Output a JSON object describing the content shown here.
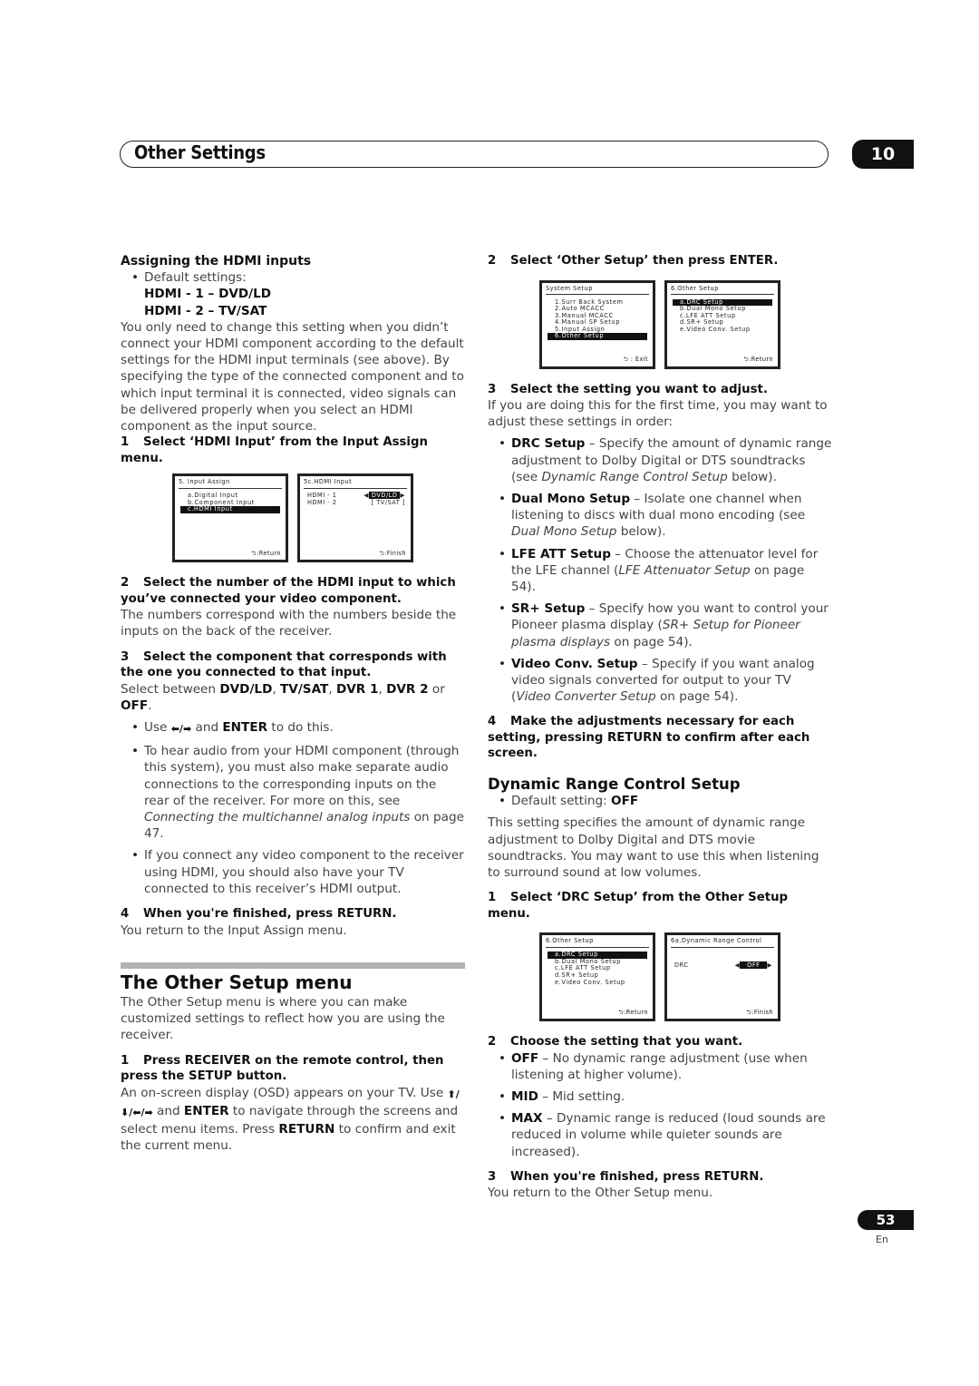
{
  "header": {
    "title": "Other Settings",
    "chapter": "10"
  },
  "left": {
    "hdmi_heading": "Assigning the HDMI inputs",
    "default_label": "Default settings:",
    "defaults": [
      "HDMI - 1 – DVD/LD",
      "HDMI - 2 – TV/SAT"
    ],
    "intro": "You only need to change this setting when you didn’t connect your HDMI component according to the default settings for the HDMI input terminals (see above). By specifying the type of the connected component and to which input terminal it is connected, video signals can be delivered properly when you select an HDMI component as the input source.",
    "step1": {
      "num": "1",
      "text": "Select ‘HDMI Input’ from the Input Assign menu."
    },
    "osd1": {
      "title": "5. Input  Assign",
      "items": [
        "a.Digital  Input",
        "b.Component  Input",
        "c.HDMI Input"
      ],
      "selected": 2,
      "footer": ":Return"
    },
    "osd2": {
      "title": "5c.HDMI  Input",
      "rows": [
        {
          "key": "HDMI - 1",
          "value": "DVD/LD",
          "selected": true
        },
        {
          "key": "HDMI - 2",
          "value": "[  TV/SAT  ]",
          "selected": false
        }
      ],
      "footer": ":Finish"
    },
    "step2": {
      "num": "2",
      "text": "Select the number of the HDMI input to which you’ve connected your video component."
    },
    "step2_body": "The numbers correspond with the numbers beside the inputs on the back of the receiver.",
    "step3": {
      "num": "3",
      "text": "Select the component that corresponds with the one you connected to that input."
    },
    "step3_body_pre": "Select between ",
    "step3_options": [
      "DVD/LD",
      "TV/SAT",
      "DVR 1",
      "DVR 2",
      "OFF"
    ],
    "step3_bullet1": {
      "pre": "Use ",
      "arrows": "⬅/➡",
      "mid": " and ",
      "key": "ENTER",
      "post": " to do this."
    },
    "step3_bullet2": {
      "text": "To hear audio from your HDMI component (through this system), you must also make separate audio connections to the corresponding inputs on the rear of the receiver. For more on this, see ",
      "ref": "Connecting the multichannel analog inputs",
      "post": " on page 47."
    },
    "step3_bullet3": "If you connect any video component to the receiver using HDMI, you should also have your TV connected to this receiver’s HDMI output.",
    "step4": {
      "num": "4",
      "text": "When you're finished, press RETURN."
    },
    "step4_body": "You return to the Input Assign menu.",
    "other_heading": "The Other Setup menu",
    "other_intro": "The Other Setup menu is where you can make customized settings to reflect how you are using the receiver.",
    "os_step1": {
      "num": "1",
      "text": "Press RECEIVER on the remote control, then press the SETUP button."
    },
    "os_step1_body": {
      "pre": "An on-screen display (OSD) appears on your TV. Use ",
      "arrows": "⬆/⬇/⬅/➡",
      "mid": " and ",
      "key1": "ENTER",
      "mid2": " to navigate through the screens and select menu items. Press ",
      "key2": "RETURN",
      "post": " to confirm and exit the current menu."
    }
  },
  "right": {
    "step2": {
      "num": "2",
      "text": "Select ‘Other Setup’ then press ENTER."
    },
    "osd_system": {
      "title": "System  Setup",
      "items": [
        "1.Surr  Back  System",
        "2.Auto  MCACC",
        "3.Manual  MCACC",
        "4.Manual  SP  Setup",
        "5.Input  Assign",
        "6.Other  Setup"
      ],
      "selected": 5,
      "footer": " : Exit"
    },
    "osd_other": {
      "title": "6.Other  Setup",
      "items": [
        "a.DRC  Setup",
        "b.Dual  Mono  Setup",
        "c.LFE  ATT  Setup",
        "d.SR+  Setup",
        "e.Video Conv. Setup"
      ],
      "selected": 0,
      "footer": ":Return"
    },
    "step3": {
      "num": "3",
      "text": "Select the setting you want to adjust."
    },
    "step3_body": "If you are doing this for the first time, you may want to adjust these settings in order:",
    "settings": [
      {
        "name": "DRC Setup",
        "desc": " – Specify the amount of dynamic range adjustment to Dolby Digital or DTS soundtracks (see ",
        "ref": "Dynamic Range Control Setup",
        "post": " below)."
      },
      {
        "name": "Dual Mono Setup",
        "desc": " – Isolate one channel when listening to discs with dual mono encoding (see ",
        "ref": "Dual Mono Setup",
        "post": " below)."
      },
      {
        "name": "LFE ATT Setup",
        "desc": " – Choose the attenuator level for the LFE channel (",
        "ref": "LFE Attenuator Setup",
        "post": " on page 54)."
      },
      {
        "name": "SR+ Setup",
        "desc": " – Specify how you want to control your Pioneer plasma display (",
        "ref": "SR+ Setup for Pioneer plasma displays",
        "post": " on page 54)."
      },
      {
        "name": "Video Conv. Setup",
        "desc": " – Specify if you want analog video signals converted for output to your TV (",
        "ref": "Video Converter Setup",
        "post": " on page 54)."
      }
    ],
    "step4": {
      "num": "4",
      "text": "Make the adjustments necessary for each setting, pressing RETURN to confirm after each screen."
    },
    "drc_heading": "Dynamic Range Control Setup",
    "drc_default_label": "Default setting: ",
    "drc_default_value": "OFF",
    "drc_intro": "This setting specifies the amount of dynamic range adjustment to Dolby Digital and DTS movie soundtracks. You may want to use this when listening to surround sound at low volumes.",
    "drc_step1": {
      "num": "1",
      "text": "Select ‘DRC Setup’ from the Other Setup menu."
    },
    "osd_other2": {
      "title": "6.Other  Setup",
      "items": [
        "a.DRC  Setup",
        "b.Dual  Mono  Setup",
        "c.LFE  ATT  Setup",
        "d.SR+  Setup",
        "e.Video Conv. Setup"
      ],
      "selected": 0,
      "footer": ":Return"
    },
    "osd_drc": {
      "title": "6a.Dynamic  Range  Control",
      "key": "DRC",
      "value": "OFF",
      "footer": ":Finish"
    },
    "drc_step2": {
      "num": "2",
      "text": "Choose the setting that you want."
    },
    "drc_options": [
      {
        "name": "OFF",
        "desc": " – No dynamic range adjustment (use when listening at higher volume)."
      },
      {
        "name": "MID",
        "desc": " – Mid setting."
      },
      {
        "name": "MAX",
        "desc": " – Dynamic range is reduced (loud sounds are reduced in volume while quieter sounds are increased)."
      }
    ],
    "drc_step3": {
      "num": "3",
      "text": "When you're finished, press RETURN."
    },
    "drc_step3_body": "You return to the Other Setup menu."
  },
  "footer": {
    "page": "53",
    "lang": "En"
  },
  "icons": {
    "return": "⮌",
    "left_arrow": "◀",
    "right_arrow": "▶"
  }
}
